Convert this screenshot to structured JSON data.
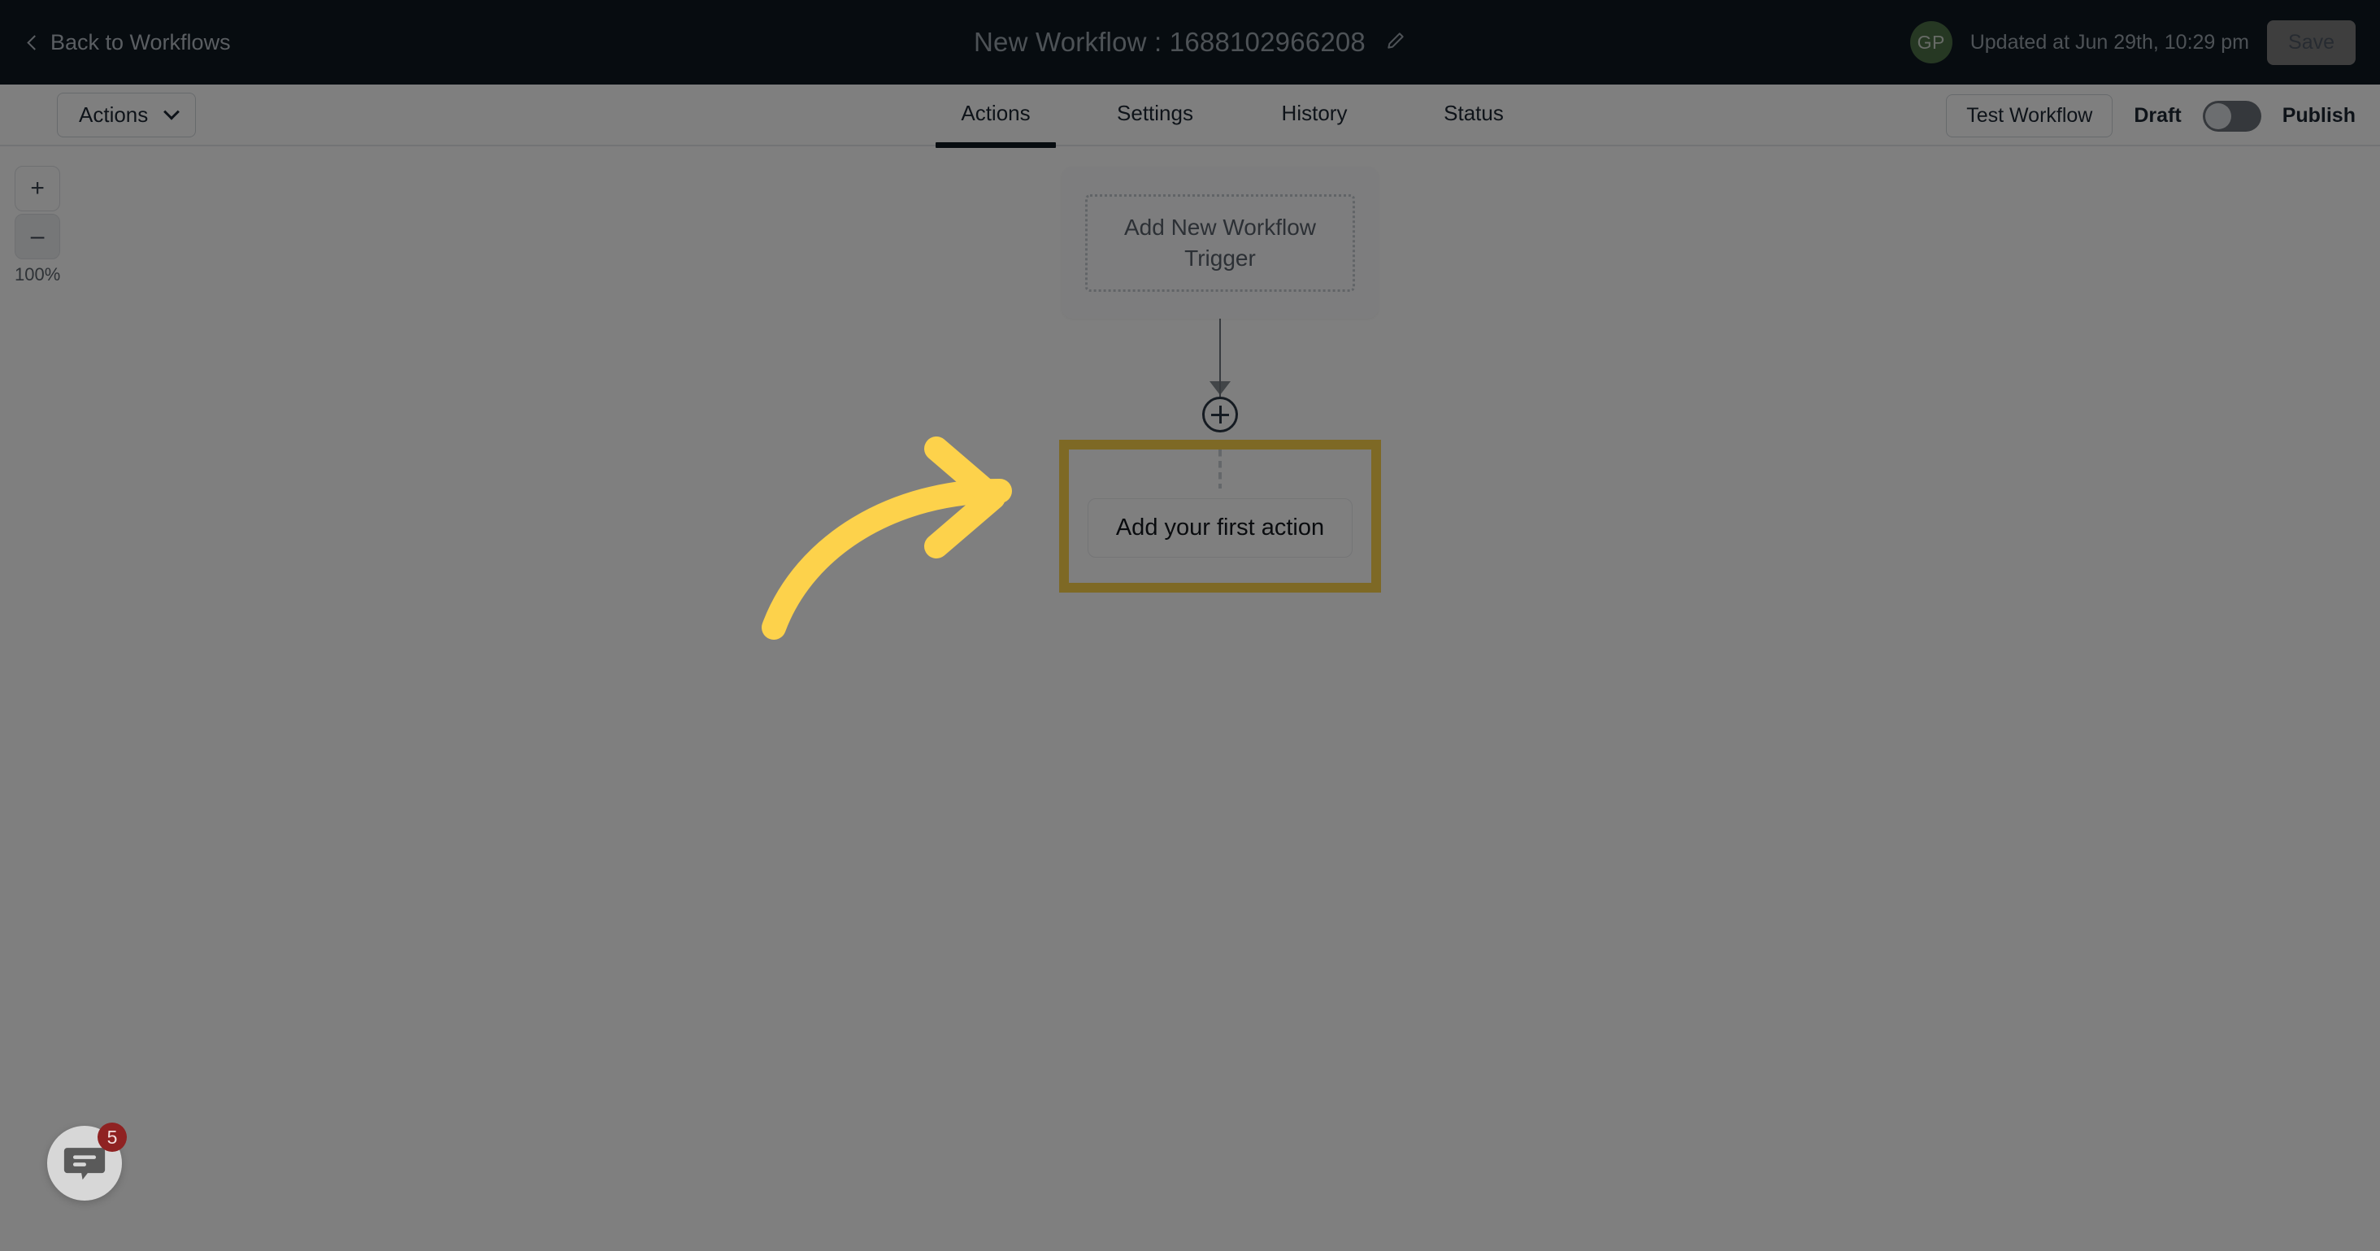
{
  "header": {
    "back_label": "Back to Workflows",
    "back_icon": "chevron-left-icon",
    "workflow_title": "New Workflow : 1688102966208",
    "edit_icon": "pencil-icon",
    "avatar_initials": "GP",
    "avatar_color": "#4c7046",
    "updated_text": "Updated at Jun 29th, 10:29 pm",
    "save_label": "Save",
    "background_color": "#0f1820"
  },
  "toolbar": {
    "actions_dropdown_label": "Actions",
    "actions_dropdown_icon": "chevron-down-icon",
    "tabs": [
      {
        "label": "Actions",
        "active": true
      },
      {
        "label": "Settings",
        "active": false
      },
      {
        "label": "History",
        "active": false
      },
      {
        "label": "Status",
        "active": false
      }
    ],
    "test_workflow_label": "Test Workflow",
    "draft_label": "Draft",
    "publish_label": "Publish",
    "toggle_state": "off"
  },
  "canvas": {
    "zoom": {
      "zoom_in_label": "+",
      "zoom_out_label": "–",
      "zoom_level": "100%"
    },
    "trigger": {
      "label": "Add New Workflow Trigger"
    },
    "add_node_icon": "plus-circle-icon",
    "action": {
      "label": "Add your first action",
      "highlighted": true,
      "highlight_color": "#FDD24B"
    }
  },
  "annotation": {
    "arrow_icon": "curved-arrow-right-icon",
    "arrow_color": "#FDD24B"
  },
  "chat": {
    "icon": "chat-bubble-icon",
    "unread_count": "5",
    "badge_color": "#8f2222"
  },
  "overlay": {
    "scrim_color": "rgba(0,0,0,0.50)"
  }
}
